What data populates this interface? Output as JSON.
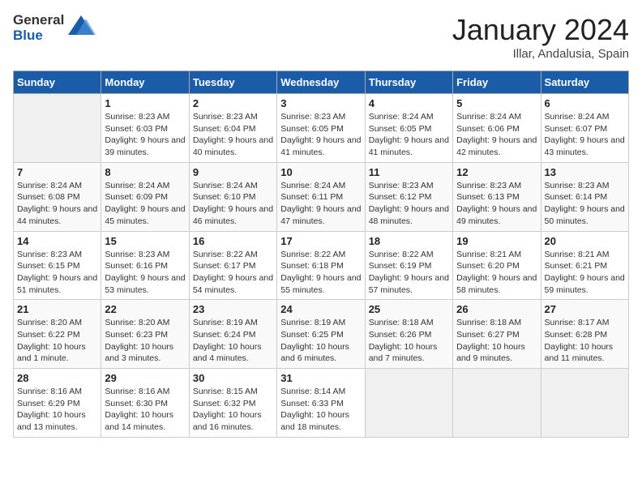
{
  "header": {
    "logo_general": "General",
    "logo_blue": "Blue",
    "month": "January 2024",
    "location": "Illar, Andalusia, Spain"
  },
  "days_of_week": [
    "Sunday",
    "Monday",
    "Tuesday",
    "Wednesday",
    "Thursday",
    "Friday",
    "Saturday"
  ],
  "weeks": [
    [
      {
        "day": "",
        "empty": true
      },
      {
        "day": "1",
        "sunrise": "Sunrise: 8:23 AM",
        "sunset": "Sunset: 6:03 PM",
        "daylight": "Daylight: 9 hours and 39 minutes."
      },
      {
        "day": "2",
        "sunrise": "Sunrise: 8:23 AM",
        "sunset": "Sunset: 6:04 PM",
        "daylight": "Daylight: 9 hours and 40 minutes."
      },
      {
        "day": "3",
        "sunrise": "Sunrise: 8:23 AM",
        "sunset": "Sunset: 6:05 PM",
        "daylight": "Daylight: 9 hours and 41 minutes."
      },
      {
        "day": "4",
        "sunrise": "Sunrise: 8:24 AM",
        "sunset": "Sunset: 6:05 PM",
        "daylight": "Daylight: 9 hours and 41 minutes."
      },
      {
        "day": "5",
        "sunrise": "Sunrise: 8:24 AM",
        "sunset": "Sunset: 6:06 PM",
        "daylight": "Daylight: 9 hours and 42 minutes."
      },
      {
        "day": "6",
        "sunrise": "Sunrise: 8:24 AM",
        "sunset": "Sunset: 6:07 PM",
        "daylight": "Daylight: 9 hours and 43 minutes."
      }
    ],
    [
      {
        "day": "7",
        "sunrise": "Sunrise: 8:24 AM",
        "sunset": "Sunset: 6:08 PM",
        "daylight": "Daylight: 9 hours and 44 minutes."
      },
      {
        "day": "8",
        "sunrise": "Sunrise: 8:24 AM",
        "sunset": "Sunset: 6:09 PM",
        "daylight": "Daylight: 9 hours and 45 minutes."
      },
      {
        "day": "9",
        "sunrise": "Sunrise: 8:24 AM",
        "sunset": "Sunset: 6:10 PM",
        "daylight": "Daylight: 9 hours and 46 minutes."
      },
      {
        "day": "10",
        "sunrise": "Sunrise: 8:24 AM",
        "sunset": "Sunset: 6:11 PM",
        "daylight": "Daylight: 9 hours and 47 minutes."
      },
      {
        "day": "11",
        "sunrise": "Sunrise: 8:23 AM",
        "sunset": "Sunset: 6:12 PM",
        "daylight": "Daylight: 9 hours and 48 minutes."
      },
      {
        "day": "12",
        "sunrise": "Sunrise: 8:23 AM",
        "sunset": "Sunset: 6:13 PM",
        "daylight": "Daylight: 9 hours and 49 minutes."
      },
      {
        "day": "13",
        "sunrise": "Sunrise: 8:23 AM",
        "sunset": "Sunset: 6:14 PM",
        "daylight": "Daylight: 9 hours and 50 minutes."
      }
    ],
    [
      {
        "day": "14",
        "sunrise": "Sunrise: 8:23 AM",
        "sunset": "Sunset: 6:15 PM",
        "daylight": "Daylight: 9 hours and 51 minutes."
      },
      {
        "day": "15",
        "sunrise": "Sunrise: 8:23 AM",
        "sunset": "Sunset: 6:16 PM",
        "daylight": "Daylight: 9 hours and 53 minutes."
      },
      {
        "day": "16",
        "sunrise": "Sunrise: 8:22 AM",
        "sunset": "Sunset: 6:17 PM",
        "daylight": "Daylight: 9 hours and 54 minutes."
      },
      {
        "day": "17",
        "sunrise": "Sunrise: 8:22 AM",
        "sunset": "Sunset: 6:18 PM",
        "daylight": "Daylight: 9 hours and 55 minutes."
      },
      {
        "day": "18",
        "sunrise": "Sunrise: 8:22 AM",
        "sunset": "Sunset: 6:19 PM",
        "daylight": "Daylight: 9 hours and 57 minutes."
      },
      {
        "day": "19",
        "sunrise": "Sunrise: 8:21 AM",
        "sunset": "Sunset: 6:20 PM",
        "daylight": "Daylight: 9 hours and 58 minutes."
      },
      {
        "day": "20",
        "sunrise": "Sunrise: 8:21 AM",
        "sunset": "Sunset: 6:21 PM",
        "daylight": "Daylight: 9 hours and 59 minutes."
      }
    ],
    [
      {
        "day": "21",
        "sunrise": "Sunrise: 8:20 AM",
        "sunset": "Sunset: 6:22 PM",
        "daylight": "Daylight: 10 hours and 1 minute."
      },
      {
        "day": "22",
        "sunrise": "Sunrise: 8:20 AM",
        "sunset": "Sunset: 6:23 PM",
        "daylight": "Daylight: 10 hours and 3 minutes."
      },
      {
        "day": "23",
        "sunrise": "Sunrise: 8:19 AM",
        "sunset": "Sunset: 6:24 PM",
        "daylight": "Daylight: 10 hours and 4 minutes."
      },
      {
        "day": "24",
        "sunrise": "Sunrise: 8:19 AM",
        "sunset": "Sunset: 6:25 PM",
        "daylight": "Daylight: 10 hours and 6 minutes."
      },
      {
        "day": "25",
        "sunrise": "Sunrise: 8:18 AM",
        "sunset": "Sunset: 6:26 PM",
        "daylight": "Daylight: 10 hours and 7 minutes."
      },
      {
        "day": "26",
        "sunrise": "Sunrise: 8:18 AM",
        "sunset": "Sunset: 6:27 PM",
        "daylight": "Daylight: 10 hours and 9 minutes."
      },
      {
        "day": "27",
        "sunrise": "Sunrise: 8:17 AM",
        "sunset": "Sunset: 6:28 PM",
        "daylight": "Daylight: 10 hours and 11 minutes."
      }
    ],
    [
      {
        "day": "28",
        "sunrise": "Sunrise: 8:16 AM",
        "sunset": "Sunset: 6:29 PM",
        "daylight": "Daylight: 10 hours and 13 minutes."
      },
      {
        "day": "29",
        "sunrise": "Sunrise: 8:16 AM",
        "sunset": "Sunset: 6:30 PM",
        "daylight": "Daylight: 10 hours and 14 minutes."
      },
      {
        "day": "30",
        "sunrise": "Sunrise: 8:15 AM",
        "sunset": "Sunset: 6:32 PM",
        "daylight": "Daylight: 10 hours and 16 minutes."
      },
      {
        "day": "31",
        "sunrise": "Sunrise: 8:14 AM",
        "sunset": "Sunset: 6:33 PM",
        "daylight": "Daylight: 10 hours and 18 minutes."
      },
      {
        "day": "",
        "empty": true
      },
      {
        "day": "",
        "empty": true
      },
      {
        "day": "",
        "empty": true
      }
    ]
  ]
}
